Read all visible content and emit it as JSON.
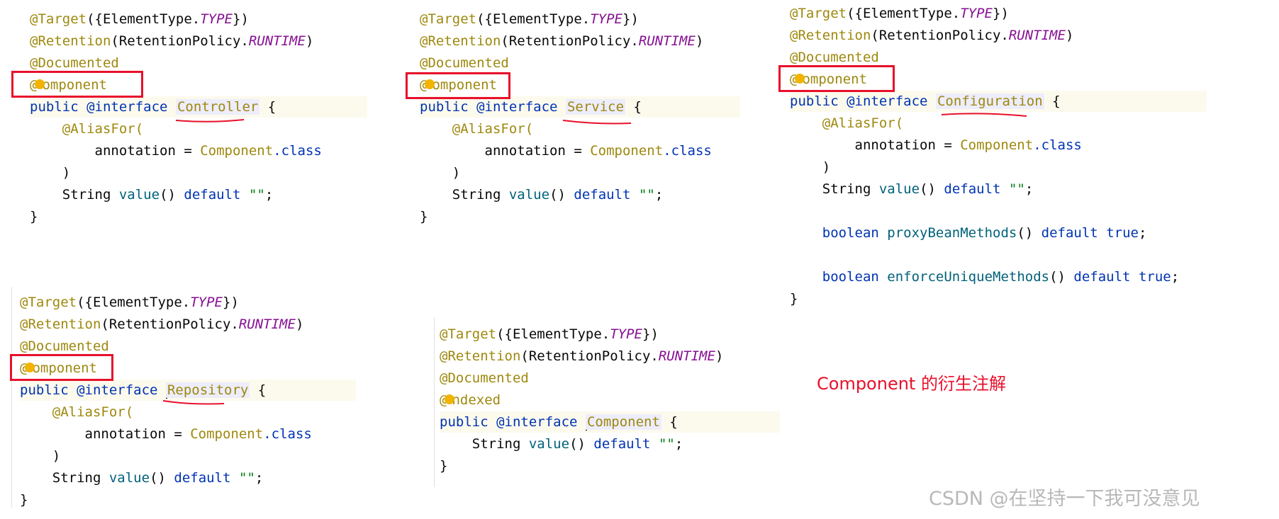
{
  "common": {
    "target_prefix": "@Target",
    "target_arg_open": "({ElementType.",
    "target_const": "TYPE",
    "target_arg_close": "})",
    "retention_prefix": "@Retention",
    "retention_arg_open": "(RetentionPolicy.",
    "retention_const": "RUNTIME",
    "retention_arg_close": ")",
    "documented": "@Documented",
    "component_at": "@",
    "component_rest": "omponent",
    "indexed_rest": "ndexed",
    "kw_public": "public",
    "kw_interface": "@interface",
    "brace_open": "{",
    "brace_close": "}",
    "aliasfor": "@AliasFor(",
    "annotation_eq": "annotation = ",
    "component_ref": "Component",
    "dot_class": ".class",
    "paren_close": ")",
    "type_string": "String",
    "method_value": "value",
    "parens": "()",
    "kw_default": "default",
    "empty_str": "\"\"",
    "semicolon": ";",
    "kw_boolean": "boolean",
    "method_proxy": "proxyBeanMethods",
    "method_enforce": "enforceUniqueMethods",
    "kw_true": "true"
  },
  "panels": {
    "controller": {
      "name": "Controller"
    },
    "service": {
      "name": "Service"
    },
    "configuration": {
      "name": "Configuration"
    },
    "repository": {
      "name": "Repository"
    },
    "component": {
      "name": "Component"
    }
  },
  "caption": "Component 的衍生注解",
  "watermark": "CSDN @在坚持一下我可没意见",
  "colors": {
    "annotation": "#9e880d",
    "keyword": "#0033b3",
    "constant": "#871094",
    "string": "#067d17",
    "highlight_box": "#e8102b"
  }
}
